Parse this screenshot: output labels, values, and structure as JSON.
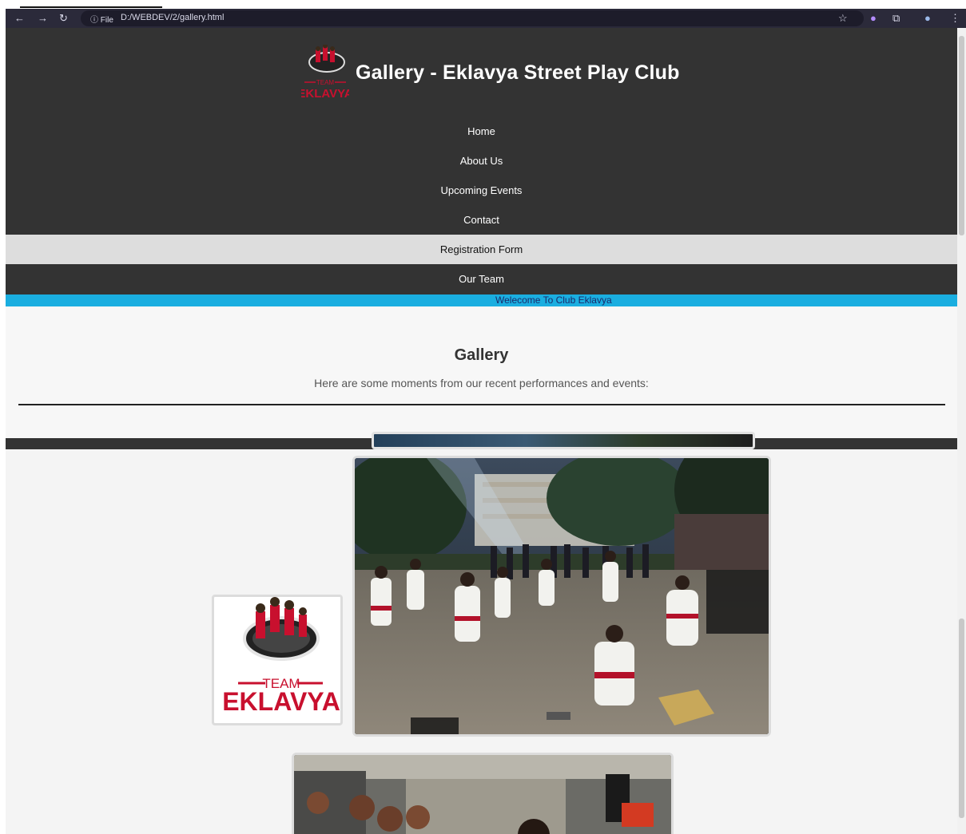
{
  "browser": {
    "file_chip": "ⓘ File",
    "url": "D:/WEBDEV/2/gallery.html"
  },
  "header": {
    "site_title": "Gallery - Eklavya Street Play Club",
    "logo_text_small": "TEAM",
    "logo_text_big": "EKLAVYA"
  },
  "menu": {
    "items": [
      {
        "label": "Home"
      },
      {
        "label": "About Us"
      },
      {
        "label": "Upcoming Events"
      },
      {
        "label": "Contact"
      },
      {
        "label": "Registration Form"
      },
      {
        "label": "Our Team"
      }
    ]
  },
  "marquee": {
    "text": "Welecome To Club Eklavya"
  },
  "gallery": {
    "title": "Gallery",
    "description": "Here are some moments from our recent performances and events:"
  },
  "colors": {
    "header_bg": "#333333",
    "marquee_bg": "#1aaee0",
    "logo_red": "#c8102e"
  }
}
